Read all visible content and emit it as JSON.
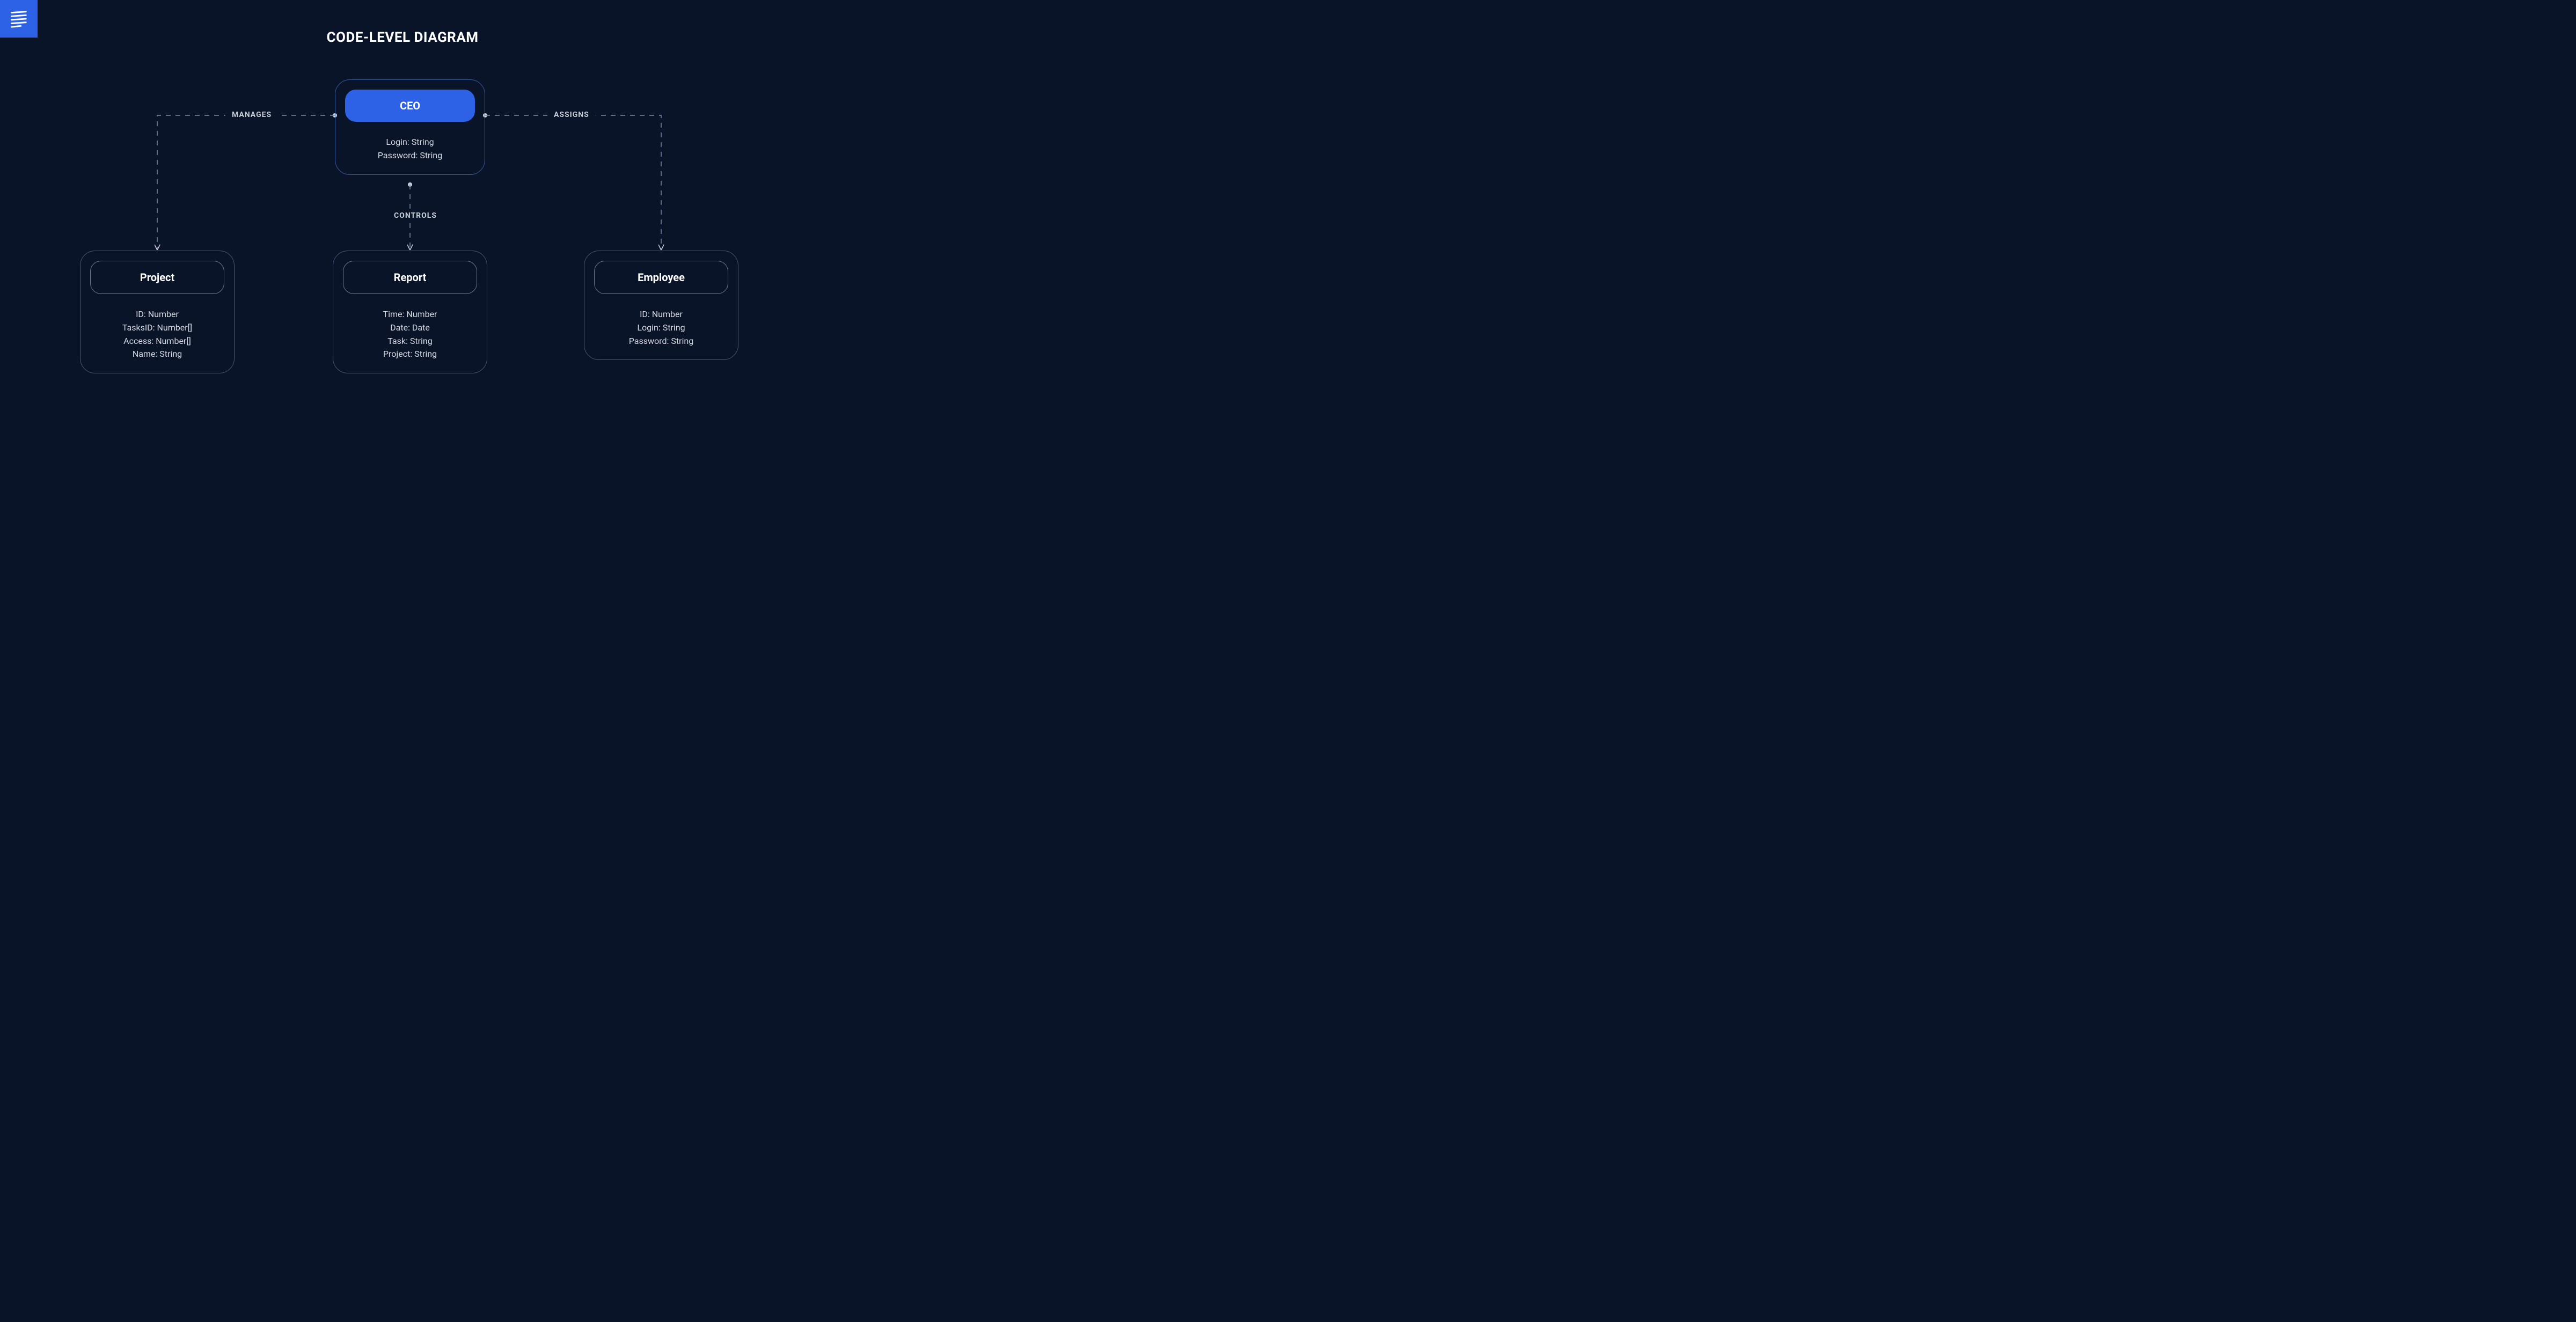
{
  "title": "CODE-LEVEL DIAGRAM",
  "entities": {
    "ceo": {
      "name": "CEO",
      "attrs": [
        "Login: String",
        "Password: String"
      ]
    },
    "project": {
      "name": "Project",
      "attrs": [
        "ID: Number",
        "TasksID: Number[]",
        "Access: Number[]",
        "Name: String"
      ]
    },
    "report": {
      "name": "Report",
      "attrs": [
        "Time: Number",
        "Date: Date",
        "Task: String",
        "Project: String"
      ]
    },
    "employee": {
      "name": "Employee",
      "attrs": [
        "ID: Number",
        "Login: String",
        "Password: String"
      ]
    }
  },
  "edges": {
    "manages": "MANAGES",
    "controls": "CONTROLS",
    "assigns": "ASSIGNS"
  },
  "colors": {
    "bg": "#0a1428",
    "accent": "#2e62e6",
    "ceo_border": "#3a5a9e",
    "child_border": "#4a5570",
    "header_border": "#6b7590",
    "dash": "#7a88a8"
  }
}
